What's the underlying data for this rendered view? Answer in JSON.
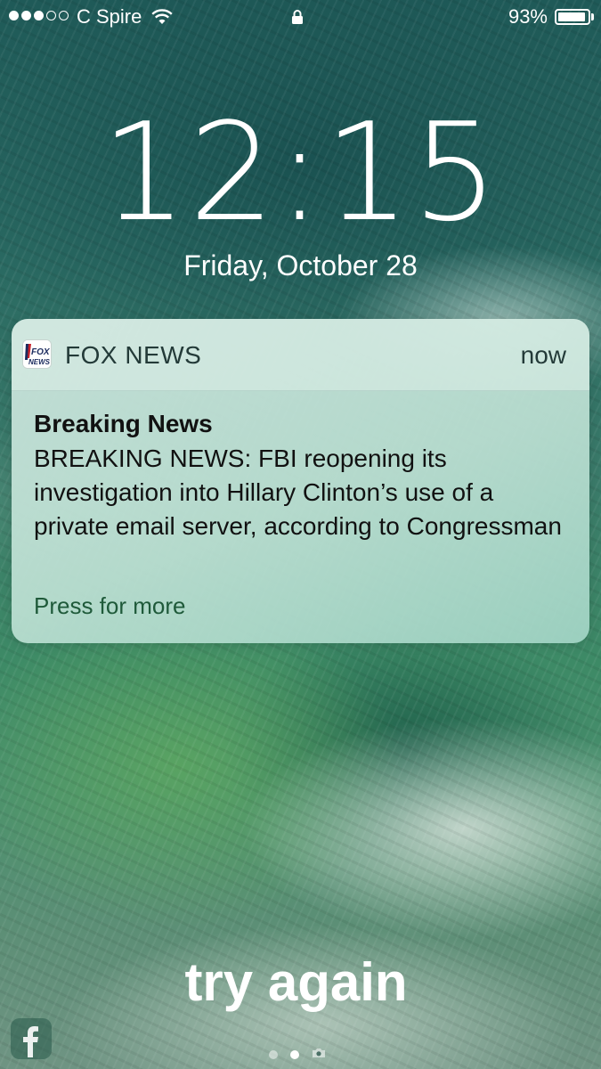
{
  "status_bar": {
    "carrier": "C Spire",
    "signal_bars_filled": 3,
    "signal_bars_total": 5,
    "battery_percent": "93%",
    "battery_level": 0.93,
    "icons": [
      "wifi-icon",
      "lock-icon",
      "battery-icon"
    ]
  },
  "lock_screen": {
    "time": "12:15",
    "date": "Friday, October 28"
  },
  "notification": {
    "app_name": "FOX NEWS",
    "app_icon_text": "FOX NEWS",
    "time": "now",
    "title": "Breaking News",
    "body": "BREAKING NEWS: FBI reopening its investigation into Hillary Clinton’s use of a private email server, according to Congressman",
    "action": "Press for more"
  },
  "overlay": {
    "text": "try again"
  },
  "bottom": {
    "shortcut_icon": "facebook-icon",
    "page_dots": 2,
    "active_page": 2,
    "camera_icon": "camera-icon"
  },
  "colors": {
    "notification_tint": "#bfe3d8",
    "action_text": "#1f5a3a",
    "header_text": "#233a38"
  }
}
